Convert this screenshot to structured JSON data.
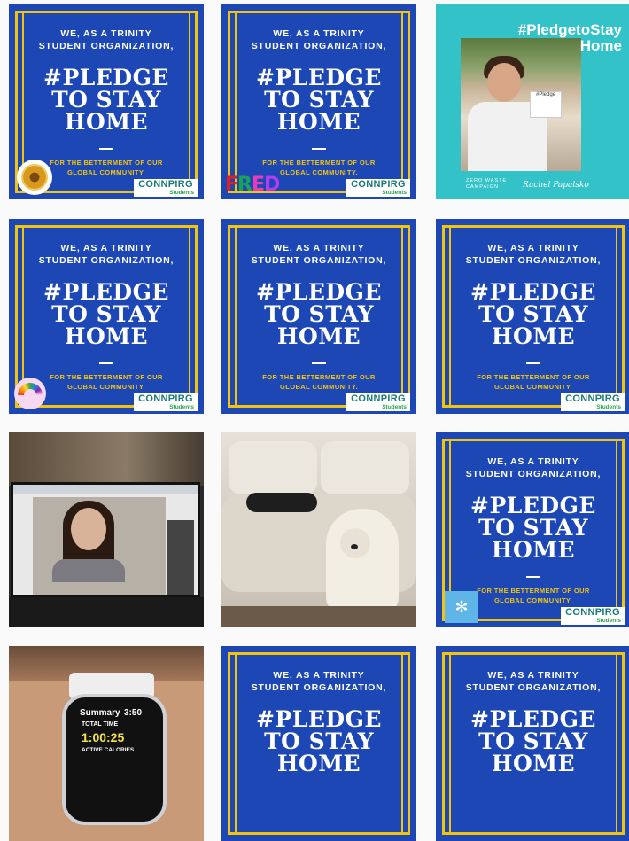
{
  "poster": {
    "line1a": "WE, AS A TRINITY",
    "line1b": "STUDENT ORGANIZATION,",
    "hashtag1": "#PLEDGE",
    "hashtag2": "TO STAY",
    "hashtag3": "HOME",
    "betterment1": "FOR THE BETTERMENT OF OUR",
    "betterment2": "GLOBAL COMMUNITY.",
    "connpirg": "CONNPIRG",
    "students": "Students"
  },
  "teal_post": {
    "title1": "#PledgetoStay",
    "title2": "Home",
    "caption_a": "ZERO WASTE",
    "caption_b": "CAMPAIGN",
    "caption_name": "Rachel Papalsko"
  },
  "fred_logo": [
    "F",
    "R",
    "E",
    "D"
  ],
  "watch": {
    "summary": "Summary",
    "time": "3:50",
    "total_time": "TOTAL TIME",
    "duration": "1:00:25",
    "active": "ACTIVE CALORIES"
  }
}
